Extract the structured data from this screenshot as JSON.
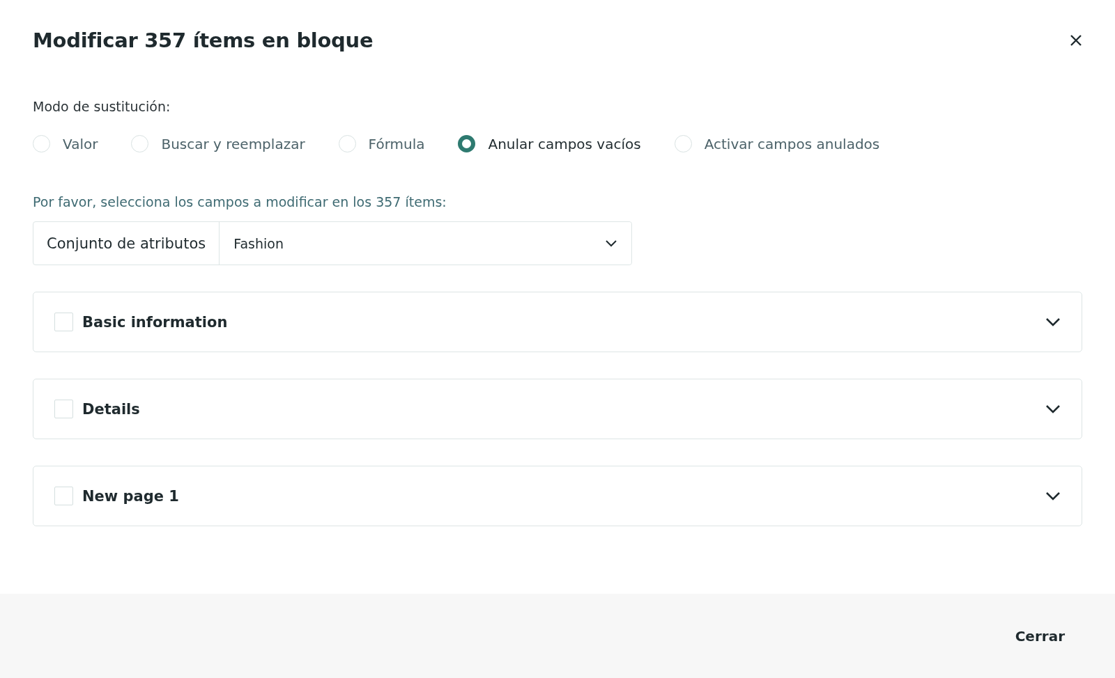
{
  "dialog": {
    "title": "Modificar 357 ítems en bloque"
  },
  "mode": {
    "label": "Modo de sustitución:",
    "options": [
      {
        "label": "Valor",
        "selected": false
      },
      {
        "label": "Buscar y reemplazar",
        "selected": false
      },
      {
        "label": "Fórmula",
        "selected": false
      },
      {
        "label": "Anular campos vacíos",
        "selected": true
      },
      {
        "label": "Activar campos anulados",
        "selected": false
      }
    ]
  },
  "instruction": "Por favor, selecciona los campos a modificar en los 357 ítems:",
  "attribute_set": {
    "label": "Conjunto de atributos",
    "value": "Fashion"
  },
  "sections": [
    {
      "title": "Basic information",
      "checked": false,
      "expanded": false
    },
    {
      "title": "Details",
      "checked": false,
      "expanded": false
    },
    {
      "title": "New page 1",
      "checked": false,
      "expanded": false
    }
  ],
  "footer": {
    "buttons": [
      "Cerrar"
    ]
  }
}
